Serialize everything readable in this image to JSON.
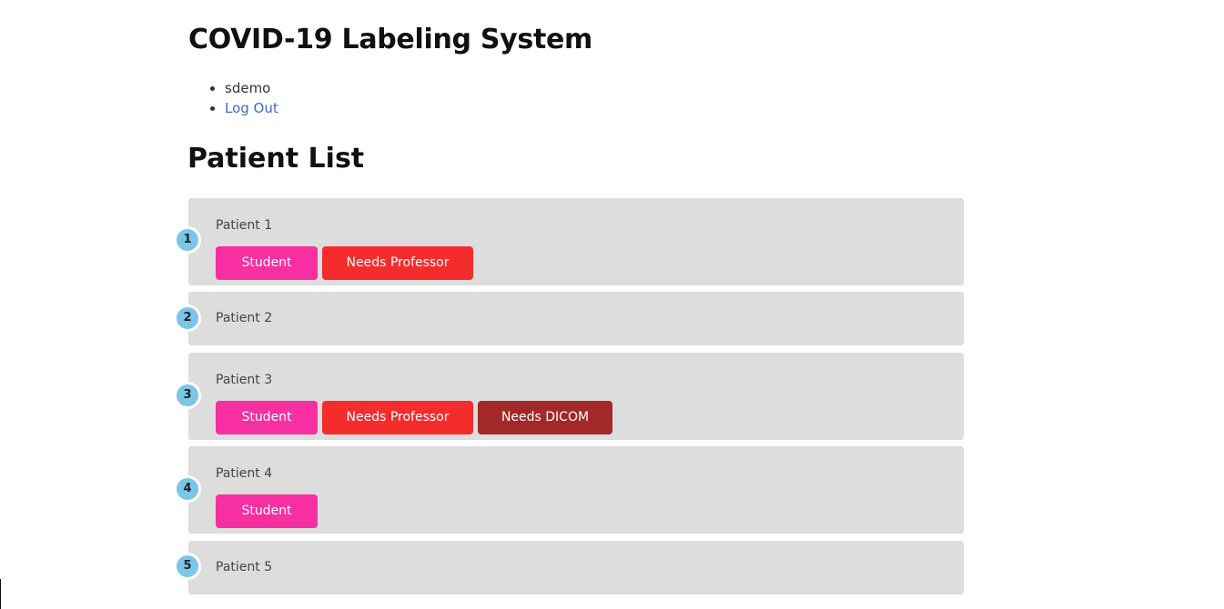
{
  "app": {
    "title": "COVID-19 Labeling System"
  },
  "user_menu": {
    "username": "sdemo",
    "logout_label": "Log Out"
  },
  "section": {
    "title": "Patient List"
  },
  "patients": [
    {
      "number": "1",
      "name": "Patient 1",
      "tags": [
        "Student",
        "Needs Professor"
      ]
    },
    {
      "number": "2",
      "name": "Patient 2",
      "tags": []
    },
    {
      "number": "3",
      "name": "Patient 3",
      "tags": [
        "Student",
        "Needs Professor",
        "Needs DICOM"
      ]
    },
    {
      "number": "4",
      "name": "Patient 4",
      "tags": [
        "Student"
      ]
    },
    {
      "number": "5",
      "name": "Patient 5",
      "tags": []
    }
  ],
  "colors": {
    "card_background": "#dddddd",
    "number_badge": "#7ac5e8",
    "tag_student": "#f72fa0",
    "tag_needs_professor": "#f52c2c",
    "tag_needs_dicom": "#a32828",
    "link": "#3f6bc7"
  }
}
